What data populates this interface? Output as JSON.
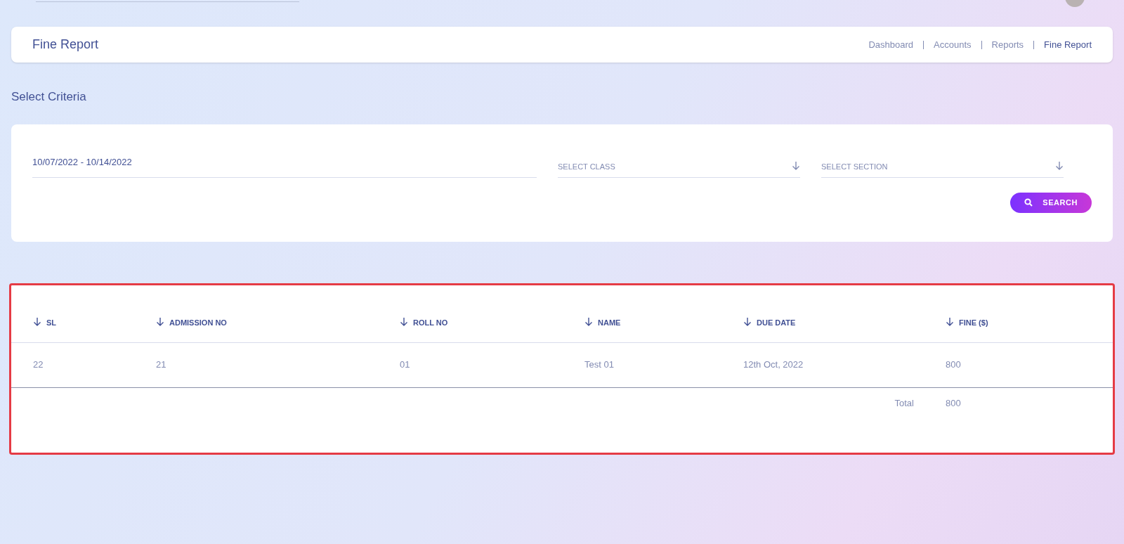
{
  "page_title": "Fine Report",
  "breadcrumb": [
    {
      "label": "Dashboard",
      "current": false
    },
    {
      "label": "Accounts",
      "current": false
    },
    {
      "label": "Reports",
      "current": false
    },
    {
      "label": "Fine Report",
      "current": true
    }
  ],
  "criteria_title": "Select Criteria",
  "filters": {
    "date_range": "10/07/2022 - 10/14/2022",
    "class_placeholder": "SELECT CLASS",
    "section_placeholder": "SELECT SECTION",
    "search_button": "SEARCH"
  },
  "table": {
    "columns": [
      "SL",
      "ADMISSION NO",
      "ROLL NO",
      "NAME",
      "DUE DATE",
      "FINE ($)"
    ],
    "rows": [
      [
        "22",
        "21",
        "01",
        "Test 01",
        "12th Oct, 2022",
        "800"
      ]
    ],
    "total_label": "Total",
    "total_value": "800"
  }
}
